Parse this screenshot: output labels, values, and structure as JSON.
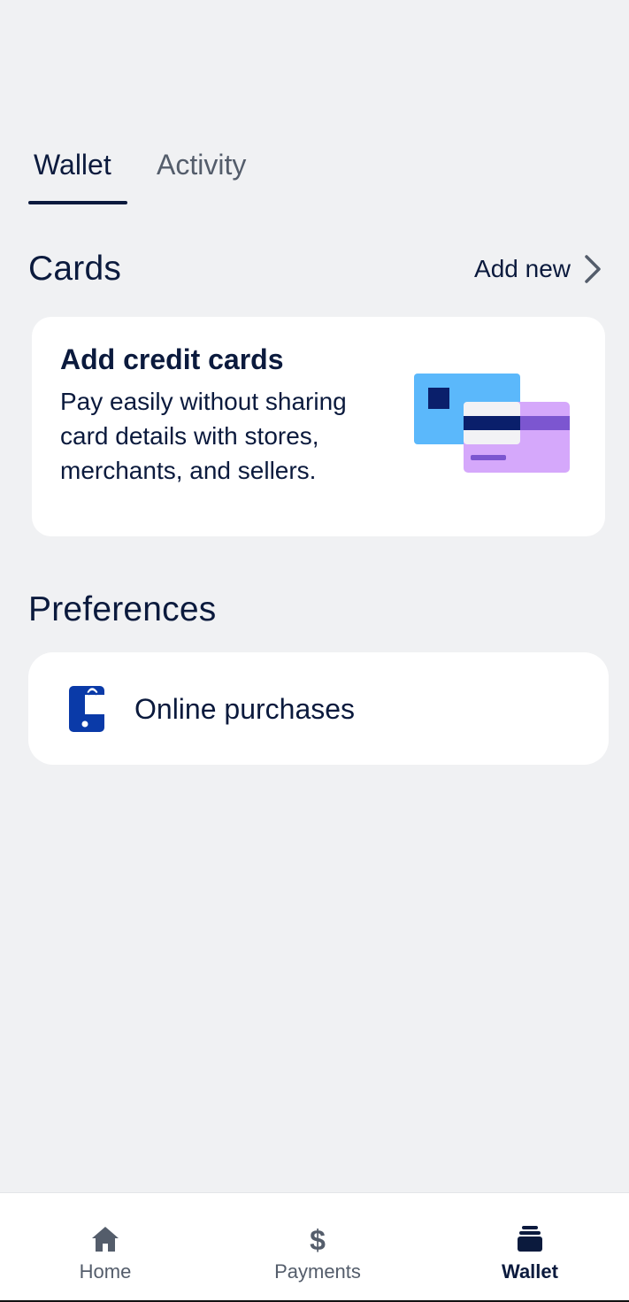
{
  "tabs": {
    "wallet": "Wallet",
    "activity": "Activity",
    "selected": "Wallet"
  },
  "cards": {
    "title": "Cards",
    "add_new": "Add new",
    "promo": {
      "title": "Add credit cards",
      "body": "Pay easily without sharing card details with stores, merchants, and sellers."
    }
  },
  "preferences": {
    "title": "Preferences",
    "items": [
      {
        "label": "Online purchases",
        "icon": "phone-shopping-bag-icon"
      }
    ]
  },
  "bottom_nav": {
    "items": [
      {
        "label": "Home",
        "icon": "home-icon"
      },
      {
        "label": "Payments",
        "icon": "dollar-icon"
      },
      {
        "label": "Wallet",
        "icon": "wallet-icon"
      }
    ],
    "selected": "Wallet"
  },
  "colors": {
    "background": "#f0f1f3",
    "text_primary": "#0b1a3d",
    "text_secondary": "#545d6b",
    "accent_blue": "#0a3aa8",
    "card_light_blue": "#5bb8fb",
    "card_purple": "#d5a8fb",
    "card_dark_purple": "#7c56d0"
  }
}
